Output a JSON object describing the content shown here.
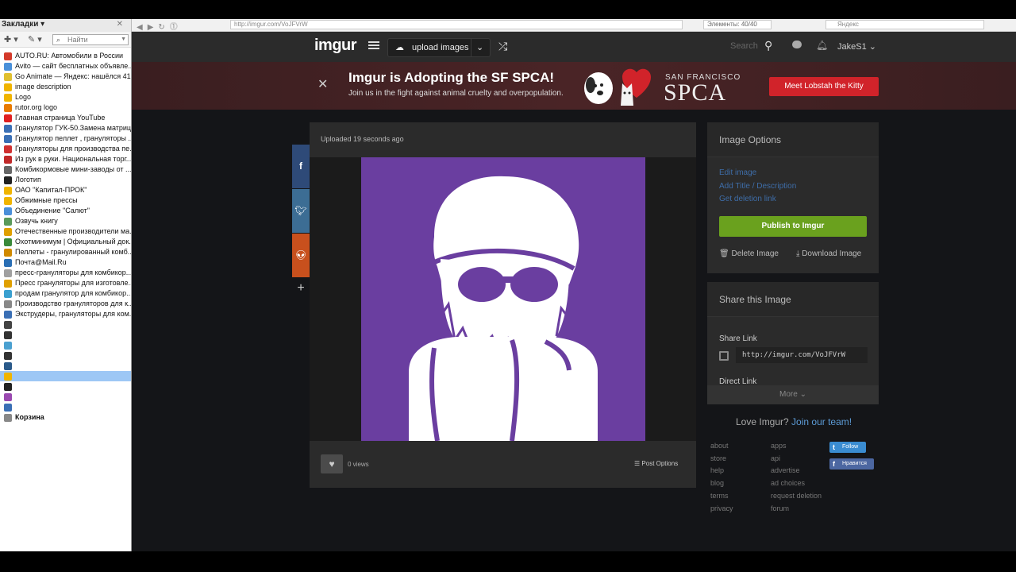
{
  "browser": {
    "bookmarks_title": "Закладки",
    "url": "http://imgur.com/VoJFVrW",
    "elements": "Элементы: 40/40",
    "yandex": "Яндекс",
    "search_placeholder": "Найти"
  },
  "bookmarks": [
    {
      "label": "AUTO.RU: Автомобили в России",
      "color": "#d43a2a"
    },
    {
      "label": "Avito — сайт бесплатных объявле...",
      "color": "#4a90d9"
    },
    {
      "label": "Go Animate — Яндекс: нашёлся 41 ...",
      "color": "#e0c030"
    },
    {
      "label": "image description",
      "color": "#f0b400"
    },
    {
      "label": "Logo",
      "color": "#f0b400"
    },
    {
      "label": "rutor.org logo",
      "color": "#e87a00"
    },
    {
      "label": "Главная страница YouTube",
      "color": "#e02020"
    },
    {
      "label": "Гранулятор ГУК-50.Замена матриц...",
      "color": "#3a6fb5"
    },
    {
      "label": "Гранулятор пеллет , грануляторы ...",
      "color": "#3a6fb5"
    },
    {
      "label": "Грануляторы для производства пе...",
      "color": "#d03030"
    },
    {
      "label": "Из рук в руки. Национальная торг...",
      "color": "#c02828"
    },
    {
      "label": "Комбикормовые мини-заводы от ...",
      "color": "#666666"
    },
    {
      "label": "Логотип",
      "color": "#222222"
    },
    {
      "label": "ОАО \"Капитал-ПРОК\"",
      "color": "#f0b400"
    },
    {
      "label": "Обжимные прессы",
      "color": "#f0b400"
    },
    {
      "label": "Объединение \"Салют\"",
      "color": "#4a8fd9"
    },
    {
      "label": "Озвучь книгу",
      "color": "#5a9a5a"
    },
    {
      "label": "Отечественные производители ма...",
      "color": "#e0a000"
    },
    {
      "label": "Охотминимум | Официальный док...",
      "color": "#3a8a3a"
    },
    {
      "label": "Пеллеты - гранулированный комб...",
      "color": "#d08a00"
    },
    {
      "label": "Почта@Mail.Ru",
      "color": "#2a6fb5"
    },
    {
      "label": "пресс-грануляторы для комбикор...",
      "color": "#a0a0a0"
    },
    {
      "label": "Пресс грануляторы для изготовле...",
      "color": "#e0a000"
    },
    {
      "label": "продам гранулятор для комбикор...",
      "color": "#3aa0d0"
    },
    {
      "label": "Производство грануляторов для к...",
      "color": "#888888"
    },
    {
      "label": "Экструдеры, грануляторы для ком...",
      "color": "#3a6fb5"
    },
    {
      "label": "",
      "color": "#444444"
    },
    {
      "label": "",
      "color": "#333333"
    },
    {
      "label": "",
      "color": "#4aa0d0"
    },
    {
      "label": "",
      "color": "#333333"
    },
    {
      "label": "",
      "color": "#2a5a8a"
    },
    {
      "label": "",
      "color": "#f0b400",
      "selected": true
    },
    {
      "label": "",
      "color": "#222222"
    },
    {
      "label": "",
      "color": "#9a4ab0"
    },
    {
      "label": "",
      "color": "#3a6fb5"
    },
    {
      "label": "Корзина",
      "color": "#888888",
      "bold": true
    }
  ],
  "nav": {
    "logo": "imgur",
    "upload_label": "upload images",
    "search_label": "Search",
    "username": "JakeS1"
  },
  "banner": {
    "title": "Imgur is Adopting the SF SPCA!",
    "subtitle": "Join us in the fight against animal cruelty and overpopulation.",
    "sf": "SAN FRANCISCO",
    "spca": "SPCA",
    "cta": "Meet Lobstah the Kitty"
  },
  "post": {
    "uploaded": "Uploaded 19 seconds ago",
    "views": "0 views",
    "post_options": "Post Options",
    "image_bg": "#6a3ea0"
  },
  "image_options": {
    "title": "Image Options",
    "edit": "Edit image",
    "add_title": "Add Title / Description",
    "deletion": "Get deletion link",
    "publish": "Publish to Imgur",
    "delete": "Delete Image",
    "download": "Download Image"
  },
  "share": {
    "title": "Share this Image",
    "share_link_label": "Share Link",
    "share_link": "http://imgur.com/VoJFVrW",
    "direct_link_label": "Direct Link",
    "more": "More"
  },
  "footer": {
    "love": "Love Imgur?",
    "join": "Join our team!",
    "col1": [
      "about",
      "store",
      "help",
      "blog",
      "terms",
      "privacy"
    ],
    "col2": [
      "apps",
      "api",
      "advertise",
      "ad choices",
      "request deletion",
      "forum"
    ],
    "follow": "Follow",
    "like": "Нравится"
  },
  "colors": {
    "accent_green": "#6aa11e",
    "link_blue": "#3e6da8",
    "cta_red": "#d1232a"
  }
}
